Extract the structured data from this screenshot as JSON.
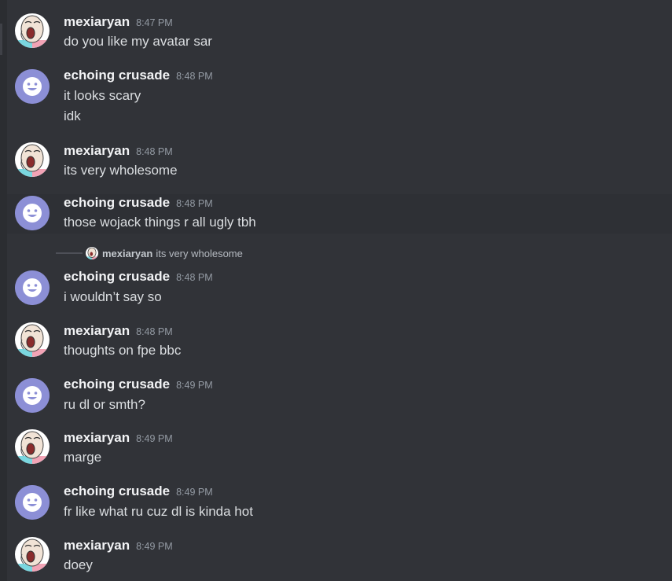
{
  "colors": {
    "background": "#313338",
    "username": "#f2f3f5",
    "message_text": "#dbdee1",
    "timestamp": "#949ba4",
    "purple_avatar": "#8c8fd6"
  },
  "reply": {
    "username": "mexiaryan",
    "text": "its very wholesome",
    "avatar_icon": "wojak-avatar-icon"
  },
  "messages": [
    {
      "user": "mexiaryan",
      "time": "8:47 PM",
      "avatar": "wojak-avatar-icon",
      "lines": [
        "do you like my avatar sar"
      ]
    },
    {
      "user": "echoing crusade",
      "time": "8:48 PM",
      "avatar": "smiley-avatar-icon",
      "lines": [
        "it looks scary",
        "idk"
      ]
    },
    {
      "user": "mexiaryan",
      "time": "8:48 PM",
      "avatar": "wojak-avatar-icon",
      "lines": [
        "its very wholesome"
      ]
    },
    {
      "user": "echoing crusade",
      "time": "8:48 PM",
      "avatar": "smiley-avatar-icon",
      "lines": [
        "those wojack things r all ugly tbh"
      ]
    },
    {
      "user": "echoing crusade",
      "time": "8:48 PM",
      "avatar": "smiley-avatar-icon",
      "lines": [
        "i wouldn’t say so"
      ]
    },
    {
      "user": "mexiaryan",
      "time": "8:48 PM",
      "avatar": "wojak-avatar-icon",
      "lines": [
        "thoughts on fpe bbc"
      ]
    },
    {
      "user": "echoing crusade",
      "time": "8:49 PM",
      "avatar": "smiley-avatar-icon",
      "lines": [
        "ru dl or smth?"
      ]
    },
    {
      "user": "mexiaryan",
      "time": "8:49 PM",
      "avatar": "wojak-avatar-icon",
      "lines": [
        "marge"
      ]
    },
    {
      "user": "echoing crusade",
      "time": "8:49 PM",
      "avatar": "smiley-avatar-icon",
      "lines": [
        "fr like what ru cuz dl is kinda hot"
      ]
    },
    {
      "user": "mexiaryan",
      "time": "8:49 PM",
      "avatar": "wojak-avatar-icon",
      "lines": [
        "doey"
      ]
    }
  ]
}
